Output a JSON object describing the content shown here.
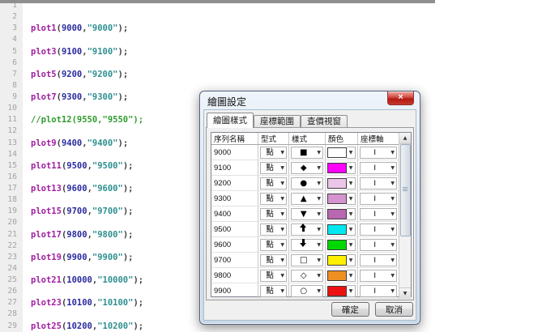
{
  "theme": {
    "syntax_function": "#a21ca2",
    "syntax_number": "#2b2b9e",
    "syntax_string": "#2e8f8f",
    "syntax_punct": "#3c3c3c",
    "syntax_comment": "#2e9b2e"
  },
  "editor": {
    "lines": [
      {
        "n": "1",
        "code": []
      },
      {
        "n": "2",
        "code": []
      },
      {
        "n": "3",
        "code": [
          [
            "plot1",
            "fn"
          ],
          [
            "(",
            "pt"
          ],
          [
            "9000",
            "nm"
          ],
          [
            ",",
            "pt"
          ],
          [
            "\"9000\"",
            "st"
          ],
          [
            ");",
            "pt"
          ]
        ]
      },
      {
        "n": "4",
        "code": []
      },
      {
        "n": "5",
        "code": [
          [
            "plot3",
            "fn"
          ],
          [
            "(",
            "pt"
          ],
          [
            "9100",
            "nm"
          ],
          [
            ",",
            "pt"
          ],
          [
            "\"9100\"",
            "st"
          ],
          [
            ");",
            "pt"
          ]
        ]
      },
      {
        "n": "6",
        "code": []
      },
      {
        "n": "7",
        "code": [
          [
            "plot5",
            "fn"
          ],
          [
            "(",
            "pt"
          ],
          [
            "9200",
            "nm"
          ],
          [
            ",",
            "pt"
          ],
          [
            "\"9200\"",
            "st"
          ],
          [
            ");",
            "pt"
          ]
        ]
      },
      {
        "n": "8",
        "code": []
      },
      {
        "n": "9",
        "code": [
          [
            "plot7",
            "fn"
          ],
          [
            "(",
            "pt"
          ],
          [
            "9300",
            "nm"
          ],
          [
            ",",
            "pt"
          ],
          [
            "\"9300\"",
            "st"
          ],
          [
            ");",
            "pt"
          ]
        ]
      },
      {
        "n": "10",
        "code": []
      },
      {
        "n": "11",
        "code": [
          [
            "//plot12(9550,\"9550\");",
            "cm"
          ]
        ]
      },
      {
        "n": "12",
        "code": []
      },
      {
        "n": "13",
        "code": [
          [
            "plot9",
            "fn"
          ],
          [
            "(",
            "pt"
          ],
          [
            "9400",
            "nm"
          ],
          [
            ",",
            "pt"
          ],
          [
            "\"9400\"",
            "st"
          ],
          [
            ");",
            "pt"
          ]
        ]
      },
      {
        "n": "14",
        "code": []
      },
      {
        "n": "15",
        "code": [
          [
            "plot11",
            "fn"
          ],
          [
            "(",
            "pt"
          ],
          [
            "9500",
            "nm"
          ],
          [
            ",",
            "pt"
          ],
          [
            "\"9500\"",
            "st"
          ],
          [
            ");",
            "pt"
          ]
        ]
      },
      {
        "n": "16",
        "code": []
      },
      {
        "n": "17",
        "code": [
          [
            "plot13",
            "fn"
          ],
          [
            "(",
            "pt"
          ],
          [
            "9600",
            "nm"
          ],
          [
            ",",
            "pt"
          ],
          [
            "\"9600\"",
            "st"
          ],
          [
            ");",
            "pt"
          ]
        ]
      },
      {
        "n": "18",
        "code": []
      },
      {
        "n": "19",
        "code": [
          [
            "plot15",
            "fn"
          ],
          [
            "(",
            "pt"
          ],
          [
            "9700",
            "nm"
          ],
          [
            ",",
            "pt"
          ],
          [
            "\"9700\"",
            "st"
          ],
          [
            ");",
            "pt"
          ]
        ]
      },
      {
        "n": "20",
        "code": []
      },
      {
        "n": "21",
        "code": [
          [
            "plot17",
            "fn"
          ],
          [
            "(",
            "pt"
          ],
          [
            "9800",
            "nm"
          ],
          [
            ",",
            "pt"
          ],
          [
            "\"9800\"",
            "st"
          ],
          [
            ");",
            "pt"
          ]
        ]
      },
      {
        "n": "22",
        "code": []
      },
      {
        "n": "23",
        "code": [
          [
            "plot19",
            "fn"
          ],
          [
            "(",
            "pt"
          ],
          [
            "9900",
            "nm"
          ],
          [
            ",",
            "pt"
          ],
          [
            "\"9900\"",
            "st"
          ],
          [
            ");",
            "pt"
          ]
        ]
      },
      {
        "n": "24",
        "code": []
      },
      {
        "n": "25",
        "code": [
          [
            "plot21",
            "fn"
          ],
          [
            "(",
            "pt"
          ],
          [
            "10000",
            "nm"
          ],
          [
            ",",
            "pt"
          ],
          [
            "\"10000\"",
            "st"
          ],
          [
            ");",
            "pt"
          ]
        ]
      },
      {
        "n": "26",
        "code": []
      },
      {
        "n": "27",
        "code": [
          [
            "plot23",
            "fn"
          ],
          [
            "(",
            "pt"
          ],
          [
            "10100",
            "nm"
          ],
          [
            ",",
            "pt"
          ],
          [
            "\"10100\"",
            "st"
          ],
          [
            ");",
            "pt"
          ]
        ]
      },
      {
        "n": "28",
        "code": []
      },
      {
        "n": "29",
        "code": [
          [
            "plot25",
            "fn"
          ],
          [
            "(",
            "pt"
          ],
          [
            "10200",
            "nm"
          ],
          [
            ",",
            "pt"
          ],
          [
            "\"10200\"",
            "st"
          ],
          [
            ");",
            "pt"
          ]
        ]
      }
    ]
  },
  "dialog": {
    "title": "繪圖設定",
    "close_glyph": "×",
    "tabs": [
      {
        "label": "繪圖樣式",
        "active": true
      },
      {
        "label": "座標範圍",
        "active": false
      },
      {
        "label": "查價視窗",
        "active": false
      }
    ],
    "table": {
      "headers": [
        "序列名稱",
        "型式",
        "樣式",
        "顏色",
        "座標軸"
      ],
      "rows": [
        {
          "series": "9000",
          "type": "點",
          "symbol": "filled-square",
          "symbol_glyph": "■",
          "color": "#ffffff",
          "axis": "I"
        },
        {
          "series": "9100",
          "type": "點",
          "symbol": "filled-diamond",
          "symbol_glyph": "◆",
          "color": "#ff00ff",
          "axis": "I"
        },
        {
          "series": "9200",
          "type": "點",
          "symbol": "filled-circle",
          "symbol_glyph": "●",
          "color": "#ecc6e8",
          "axis": "I"
        },
        {
          "series": "9300",
          "type": "點",
          "symbol": "triangle-up",
          "symbol_glyph": "▲",
          "color": "#d594cf",
          "axis": "I"
        },
        {
          "series": "9400",
          "type": "點",
          "symbol": "triangle-down",
          "symbol_glyph": "▼",
          "color": "#b867b0",
          "axis": "I"
        },
        {
          "series": "9500",
          "type": "點",
          "symbol": "arrow-up",
          "symbol_glyph": "⬆",
          "color": "#00e8f0",
          "axis": "I"
        },
        {
          "series": "9600",
          "type": "點",
          "symbol": "arrow-down",
          "symbol_glyph": "⬇",
          "color": "#00d800",
          "axis": "I"
        },
        {
          "series": "9700",
          "type": "點",
          "symbol": "hollow-square",
          "symbol_glyph": "□",
          "color": "#fff000",
          "axis": "I"
        },
        {
          "series": "9800",
          "type": "點",
          "symbol": "hollow-diamond",
          "symbol_glyph": "◇",
          "color": "#ee8f22",
          "axis": "I"
        },
        {
          "series": "9900",
          "type": "點",
          "symbol": "hollow-circle",
          "symbol_glyph": "○",
          "color": "#ee1111",
          "axis": "I"
        }
      ]
    },
    "icons": {
      "dropdown": "▼",
      "scroll_up": "▲",
      "scroll_down": "▼"
    },
    "buttons": {
      "ok": "確定",
      "cancel": "取消"
    }
  }
}
